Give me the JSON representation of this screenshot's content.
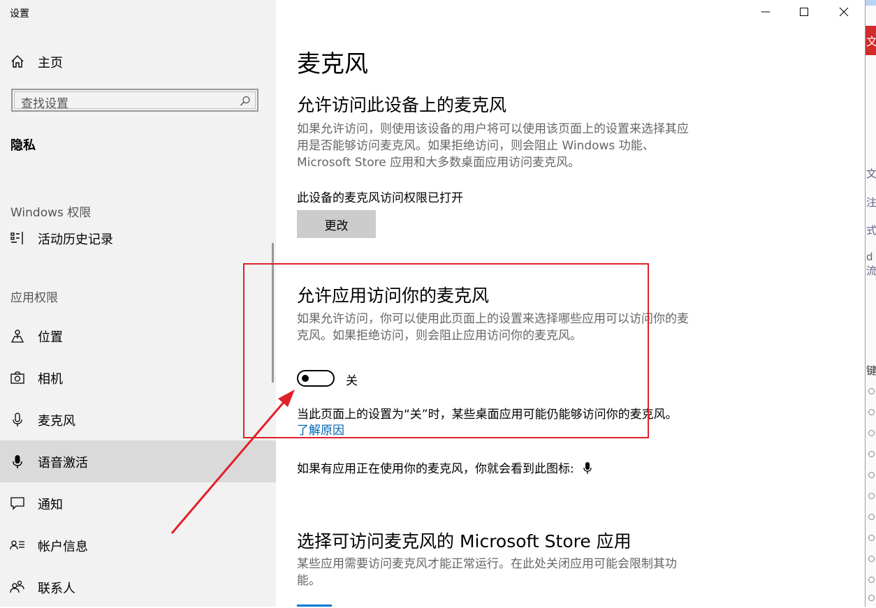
{
  "window": {
    "title": "设置",
    "controls": [
      "minimize-icon",
      "maximize-icon",
      "close-icon"
    ]
  },
  "sidebar": {
    "home_label": "主页",
    "search_placeholder": "查找设置",
    "section_heading": "隐私",
    "groups": {
      "windows_permissions": "Windows 权限",
      "app_permissions": "应用权限"
    },
    "items": [
      {
        "label": "活动历史记录",
        "icon": "activity-history-icon"
      },
      {
        "label": "位置",
        "icon": "location-icon"
      },
      {
        "label": "相机",
        "icon": "camera-icon"
      },
      {
        "label": "麦克风",
        "icon": "microphone-icon"
      },
      {
        "label": "语音激活",
        "icon": "voice-activation-icon",
        "selected": true
      },
      {
        "label": "通知",
        "icon": "notification-icon"
      },
      {
        "label": "帐户信息",
        "icon": "account-info-icon"
      },
      {
        "label": "联系人",
        "icon": "contacts-icon"
      }
    ]
  },
  "main": {
    "page_title": "麦克风",
    "device_access": {
      "heading": "允许访问此设备上的麦克风",
      "description": "如果允许访问，则使用该设备的用户将可以使用该页面上的设置来选择其应用是否能够访问麦克风。如果拒绝访问，则会阻止 Windows 功能、Microsoft Store 应用和大多数桌面应用访问麦克风。",
      "status": "此设备的麦克风访问权限已打开",
      "change_button": "更改"
    },
    "app_access": {
      "heading": "允许应用访问你的麦克风",
      "description": "如果允许访问，你可以使用此页面上的设置来选择哪些应用可以访问你的麦克风。如果拒绝访问，则会阻止应用访问你的麦克风。",
      "toggle_state": "关",
      "note": "当此页面上的设置为“关”时，某些桌面应用可能仍能够访问你的麦克风。",
      "learn_link": "了解原因"
    },
    "in_use_note": "如果有应用正在使用你的麦克风，你就会看到此图标:",
    "store_apps": {
      "heading": "选择可访问麦克风的 Microsoft Store 应用",
      "description": "某些应用需要访问麦克风才能正常运行。在此处关闭应用可能会限制其功能。"
    }
  },
  "background_window": {
    "chars": [
      "文",
      "文",
      "注",
      "式",
      "d流",
      "键"
    ]
  },
  "colors": {
    "accent": "#0078d4",
    "link": "#0066b4",
    "annotation": "#e0202a",
    "sidebar_bg": "#f2f2f2",
    "selected_bg": "#dadada"
  }
}
